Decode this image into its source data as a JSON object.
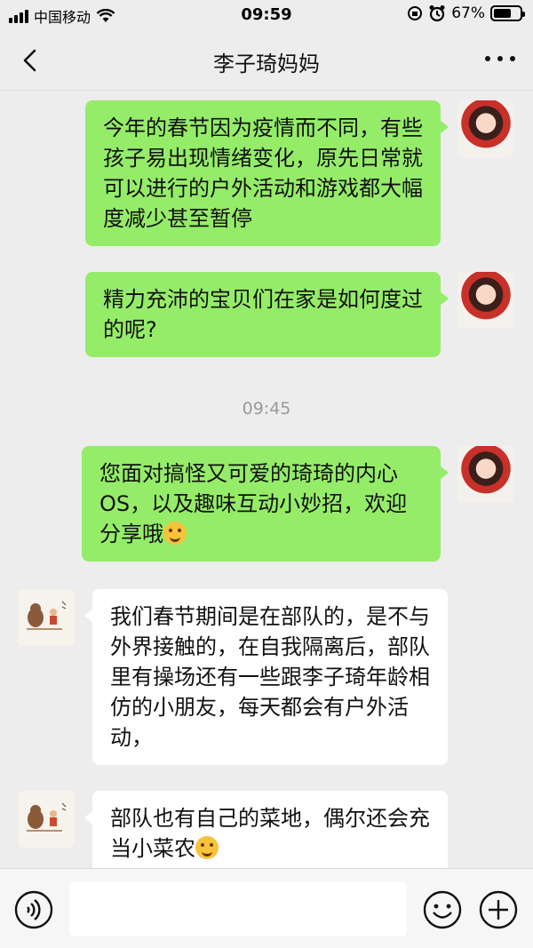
{
  "status_bar": {
    "carrier": "中国移动",
    "time": "09:59",
    "battery_percent": "67%",
    "battery_level": 0.67
  },
  "nav": {
    "title": "李子琦妈妈",
    "back_icon": "chevron-left-icon",
    "more_icon": "more-dots-icon"
  },
  "messages": [
    {
      "side": "right",
      "text": "今年的春节因为疫情而不同，有些孩子易出现情绪变化，原先日常就可以进行的户外活动和游戏都大幅度减少甚至暂停"
    },
    {
      "side": "right",
      "text": "精力充沛的宝贝们在家是如何度过的呢?"
    },
    {
      "side": "right",
      "text": "您面对搞怪又可爱的琦琦的内心OS，以及趣味互动小妙招，欢迎分享哦",
      "emoji": "shy-face-emoji"
    },
    {
      "side": "left",
      "text": "我们春节期间是在部队的，是不与外界接触的，在自我隔离后，部队里有操场还有一些跟李子琦年龄相仿的小朋友，每天都会有户外活动，"
    },
    {
      "side": "left",
      "text": "部队也有自己的菜地，偶尔还会充当小菜农",
      "emoji": "laughing-tears-emoji"
    }
  ],
  "timestamp": "09:45",
  "input_bar": {
    "voice_icon": "voice-icon",
    "emoji_icon": "emoji-icon",
    "plus_icon": "plus-icon",
    "input_value": ""
  },
  "colors": {
    "background": "#ededed",
    "bubble_green": "#95ec69",
    "bubble_white": "#ffffff",
    "timestamp": "#9a9a9a"
  }
}
